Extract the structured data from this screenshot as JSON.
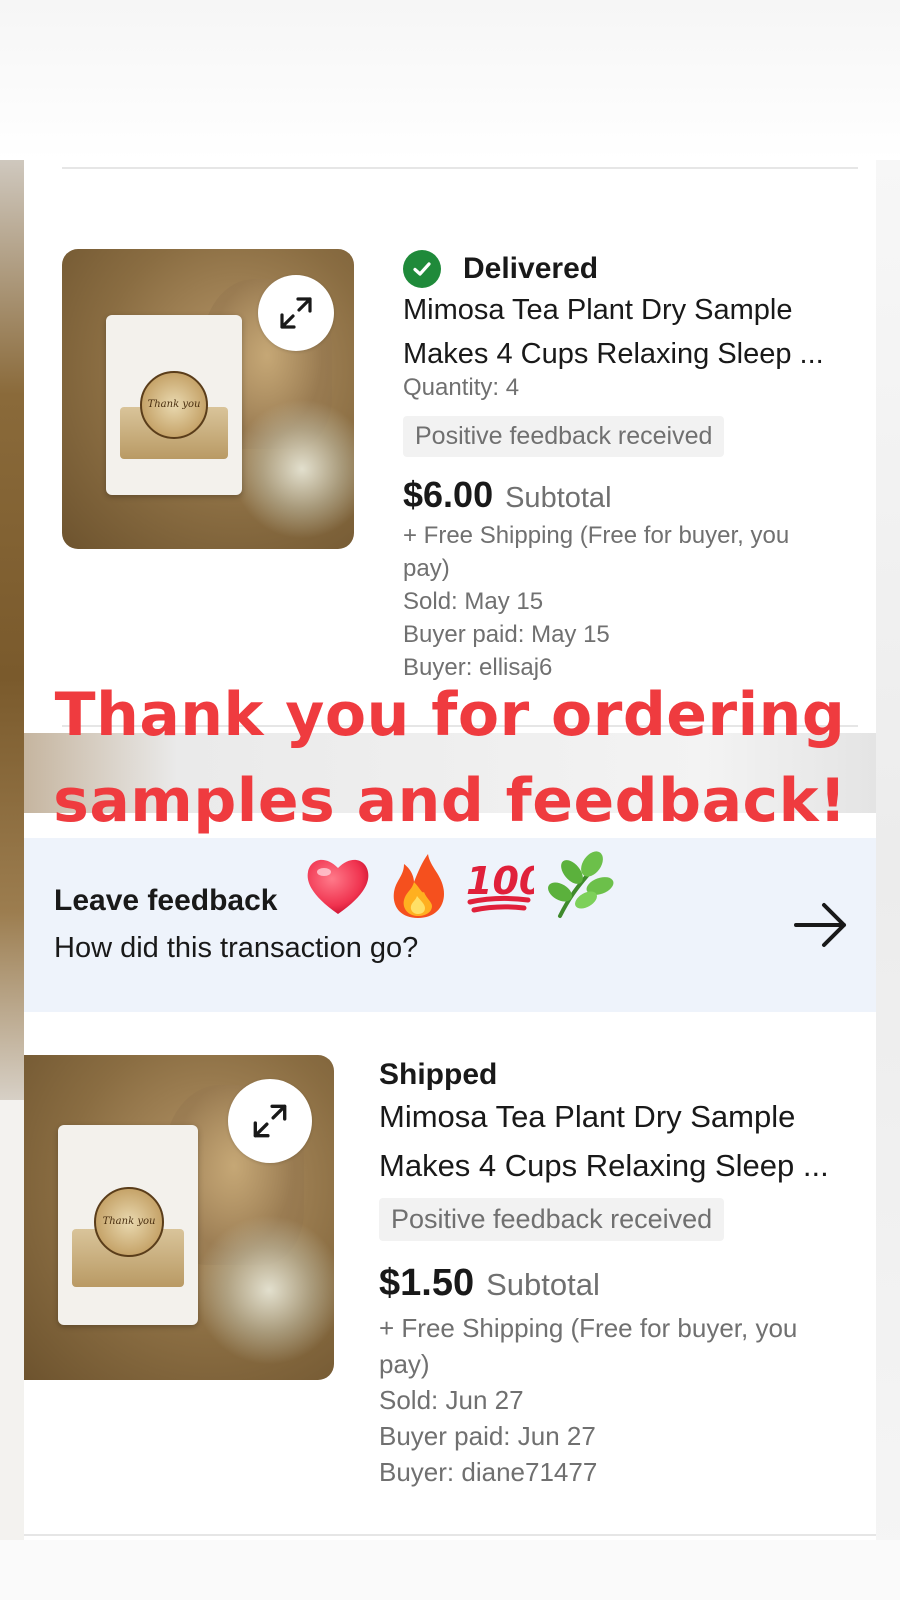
{
  "orders": [
    {
      "status": "Delivered",
      "title_line1": "Mimosa Tea Plant Dry Sample",
      "title_line2": "Makes 4 Cups Relaxing Sleep ...",
      "quantity": "Quantity: 4",
      "feedback_badge": "Positive feedback received",
      "price": "$6.00",
      "subtotal_label": "Subtotal",
      "shipping_line1": "+ Free Shipping (Free for buyer, you",
      "shipping_line2": "pay)",
      "sold": "Sold: May 15",
      "buyer_paid": "Buyer paid: May 15",
      "buyer": "Buyer: ellisaj6",
      "seal_text": "Thank you"
    },
    {
      "status": "Shipped",
      "title_line1": "Mimosa Tea Plant Dry Sample",
      "title_line2": "Makes 4 Cups Relaxing Sleep ...",
      "feedback_badge": "Positive feedback received",
      "price": "$1.50",
      "subtotal_label": "Subtotal",
      "shipping_line1": "+ Free Shipping (Free for buyer, you",
      "shipping_line2": "pay)",
      "sold": "Sold: Jun 27",
      "buyer_paid": "Buyer paid: Jun 27",
      "buyer": "Buyer: diane71477",
      "seal_text": "Thank you"
    }
  ],
  "leave_feedback": {
    "title": "Leave feedback",
    "subtitle": "How did this transaction go?"
  },
  "overlay": {
    "line1": "Thank you for ordering",
    "line2": "samples and feedback!",
    "emojis": [
      "heart-emoji",
      "fire-emoji",
      "hundred-points-emoji",
      "herb-emoji"
    ]
  },
  "colors": {
    "overlay_text": "#ef3b3f",
    "delivered_check": "#1f8a3a",
    "feedback_band": "#eef3fb",
    "muted_text": "#707070"
  }
}
